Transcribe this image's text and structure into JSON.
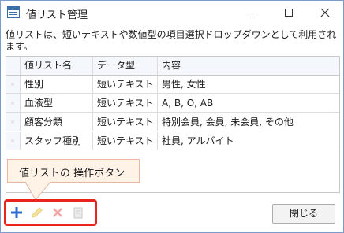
{
  "window": {
    "title": "値リスト管理"
  },
  "description": "値リストは、短いテキストや数値型の項目選択ドロップダウンとして利用されます。",
  "table": {
    "columns": [
      "値リスト名",
      "データ型",
      "内容"
    ],
    "rows": [
      [
        "性別",
        "短いテキスト",
        "男性, 女性"
      ],
      [
        "血液型",
        "短いテキスト",
        "A, B, O, AB"
      ],
      [
        "顧客分類",
        "短いテキスト",
        "特別会員, 会員, 未会員, その他"
      ],
      [
        "スタッフ種別",
        "短いテキスト",
        "社員, アルバイト"
      ]
    ]
  },
  "callout": {
    "text": "値リストの 操作ボタン"
  },
  "toolbar": {
    "icons": [
      "add-icon",
      "edit-icon",
      "delete-icon",
      "copy-icon"
    ]
  },
  "close_button": {
    "label": "閉じる"
  },
  "colors": {
    "accent_blue": "#2f6fd0",
    "highlight_red": "#e8241c",
    "callout_bg": "#fff3e8"
  }
}
